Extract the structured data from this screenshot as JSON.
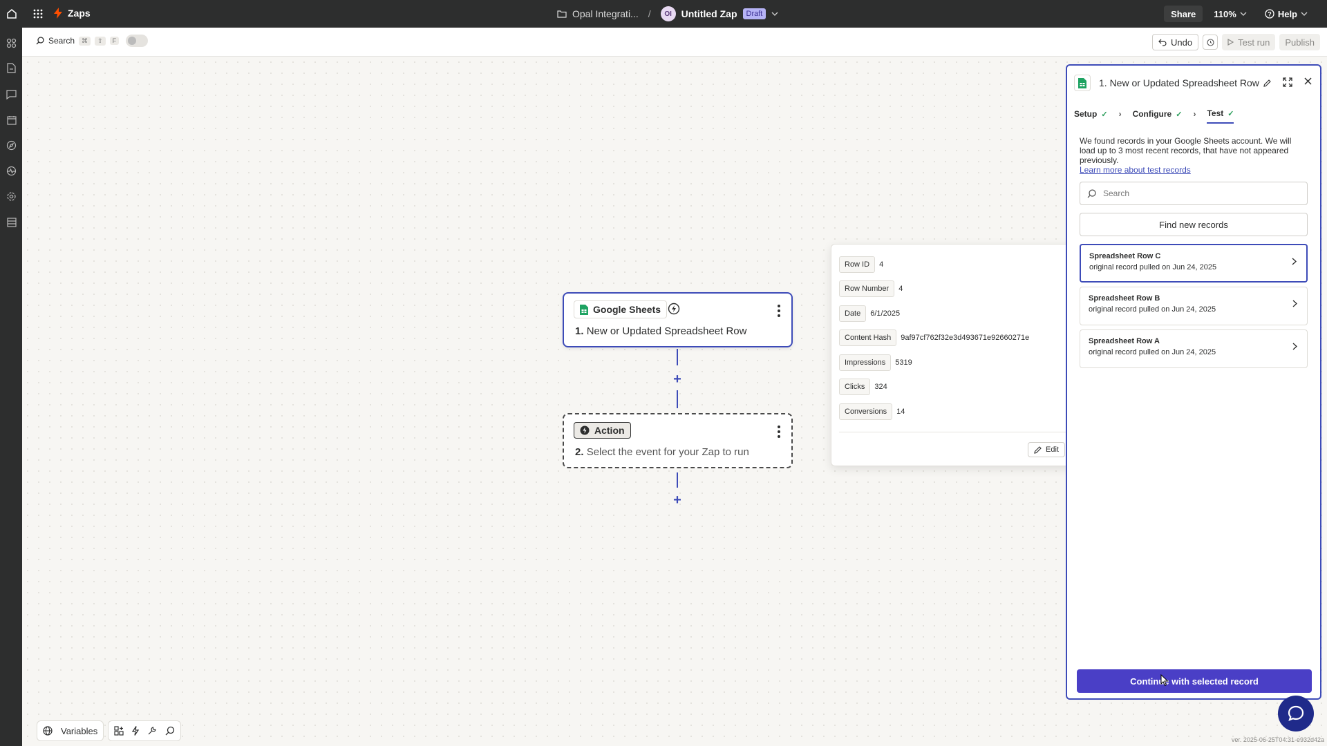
{
  "topbar": {
    "app_name": "Zaps",
    "folder_name": "Opal Integrati...",
    "path_separator": "/",
    "avatar_initials": "OI",
    "zap_name": "Untitled Zap",
    "status_badge": "Draft",
    "share_label": "Share",
    "zoom_label": "110%",
    "help_label": "Help"
  },
  "toolbar": {
    "search_label": "Search",
    "shortcut_keys": [
      "⌘",
      "⇧",
      "F"
    ],
    "undo_label": "Undo",
    "test_run_label": "Test run",
    "publish_label": "Publish"
  },
  "canvas": {
    "trigger": {
      "app_label": "Google Sheets",
      "step_number": "1.",
      "title": "New or Updated Spreadsheet Row"
    },
    "action": {
      "chip_label": "Action",
      "step_number": "2.",
      "title": "Select the event for your Zap to run"
    },
    "plus_symbol": "+"
  },
  "record_detail": {
    "fields": [
      {
        "key": "Row ID",
        "value": "4"
      },
      {
        "key": "Row Number",
        "value": "4"
      },
      {
        "key": "Date",
        "value": "6/1/2025"
      },
      {
        "key": "Content Hash",
        "value": "9af97cf762f32e3d493671e92660271e"
      },
      {
        "key": "Impressions",
        "value": "5319"
      },
      {
        "key": "Clicks",
        "value": "324"
      },
      {
        "key": "Conversions",
        "value": "14"
      }
    ],
    "edit_label": "Edit"
  },
  "panel": {
    "title": "1. New or Updated Spreadsheet Row",
    "tabs": [
      {
        "label": "Setup",
        "complete": true
      },
      {
        "label": "Configure",
        "complete": true
      },
      {
        "label": "Test",
        "complete": true
      }
    ],
    "description": "We found records in your Google Sheets account. We will load up to 3 most recent records, that have not appeared previously.",
    "learn_more": "Learn more about test records",
    "search_placeholder": "Search",
    "find_button": "Find new records",
    "records": [
      {
        "name": "Spreadsheet Row C",
        "meta": "original record pulled on Jun 24, 2025",
        "selected": true
      },
      {
        "name": "Spreadsheet Row B",
        "meta": "original record pulled on Jun 24, 2025",
        "selected": false
      },
      {
        "name": "Spreadsheet Row A",
        "meta": "original record pulled on Jun 24, 2025",
        "selected": false
      }
    ],
    "continue_button": "Continue with selected record"
  },
  "bottom_toolbar": {
    "variables_label": "Variables"
  },
  "version_text": "ver. 2025-06-25T04:31-e932d42a",
  "colors": {
    "accent": "#3d4bb8",
    "primary_button": "#4a3fc6",
    "brand_orange": "#ff4f00",
    "topbar_bg": "#2d2e2e",
    "sheets_green": "#1ea362"
  }
}
